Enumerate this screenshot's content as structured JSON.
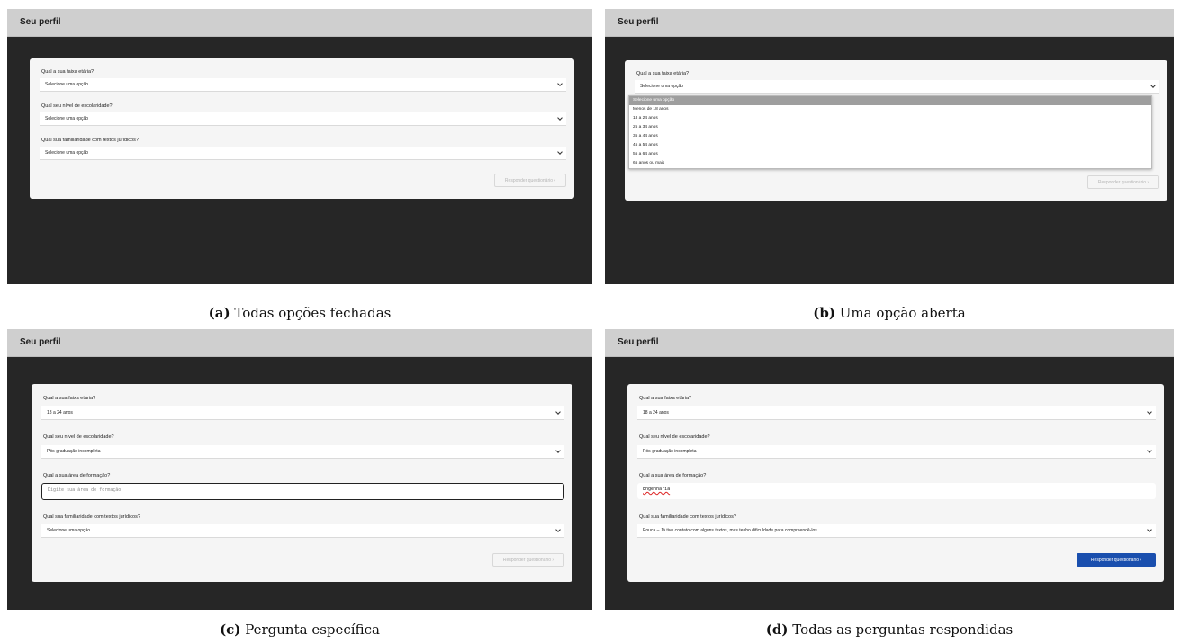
{
  "header_title": "Seu perfil",
  "labels": {
    "age": "Qual a sua faixa etária?",
    "education": "Qual seu nível de escolaridade?",
    "area": "Qual a sua área de formação?",
    "familiarity": "Qual sua familiaridade com textos jurídicos?"
  },
  "placeholders": {
    "select": "Selecione uma opção",
    "area": "Digite sua área de formação"
  },
  "answers": {
    "age": "18 a 24 anos",
    "education": "Pós-graduação incompleta",
    "area": "Engenharia",
    "familiarity": "Pouca – Já tive contato com alguns textos, mas tenho dificuldade para compreendê-los"
  },
  "age_options": [
    "Selecione uma opção",
    "Menos de 18 anos",
    "18 a 24 anos",
    "25 a 34 anos",
    "35 a 44 anos",
    "45 a 54 anos",
    "55 a 64 anos",
    "65 anos ou mais"
  ],
  "submit_label": "Responder questionário ›",
  "captions": {
    "a": {
      "letter": "(a)",
      "text": "Todas opções fechadas"
    },
    "b": {
      "letter": "(b)",
      "text": "Uma opção aberta"
    },
    "c": {
      "letter": "(c)",
      "text": "Pergunta específica"
    },
    "d": {
      "letter": "(d)",
      "text": "Todas as perguntas respondidas"
    }
  }
}
